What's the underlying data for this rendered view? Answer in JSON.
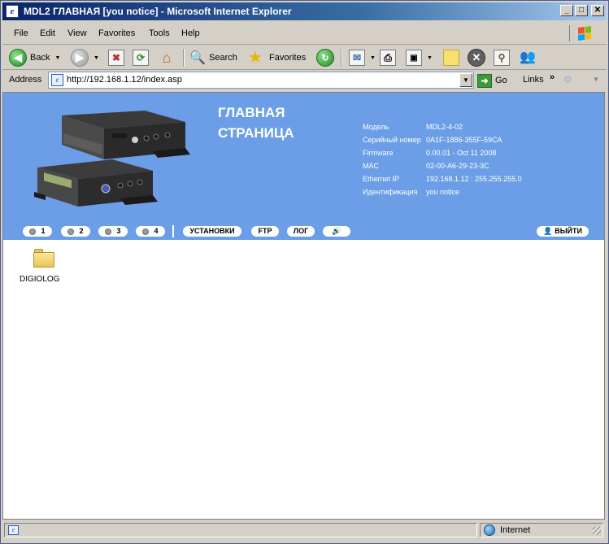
{
  "window": {
    "title": "MDL2 ГЛАВНАЯ [you notice] - Microsoft Internet Explorer",
    "minimize": "_",
    "maximize": "□",
    "close": "✕"
  },
  "menu": [
    "File",
    "Edit",
    "View",
    "Favorites",
    "Tools",
    "Help"
  ],
  "toolbar": {
    "back_label": "Back",
    "search_label": "Search",
    "favorites_label": "Favorites"
  },
  "address": {
    "label": "Address",
    "url": "http://192.168.1.12/index.asp",
    "go_label": "Go",
    "links_label": "Links"
  },
  "page": {
    "heading_line1": "ГЛАВНАЯ",
    "heading_line2": "СТРАНИЦА",
    "info": [
      {
        "key": "Модель",
        "value": "MDL2-4-02"
      },
      {
        "key": "Серийный номер",
        "value": "0A1F-1886-355F-59CA"
      },
      {
        "key": "Firmware",
        "value": "0.00.01 - Oct 11 2008"
      },
      {
        "key": "MAC",
        "value": "02-00-A6-29-23-3C"
      },
      {
        "key": "Ethernet IP",
        "value": "192.168.1.12 : 255.255.255.0"
      },
      {
        "key": "Идентификация",
        "value": "you notice"
      }
    ],
    "nav": {
      "ch1": "1",
      "ch2": "2",
      "ch3": "3",
      "ch4": "4",
      "settings": "УСТАНОВКИ",
      "ftp": "FTP",
      "log": "ЛОГ",
      "sound": "🔊",
      "logout": "ВЫЙТИ"
    },
    "folder_label": "DIGIOLOG"
  },
  "status": {
    "zone": "Internet"
  },
  "colors": {
    "banner": "#6b9ee6",
    "titlebar": "#0a246a"
  }
}
